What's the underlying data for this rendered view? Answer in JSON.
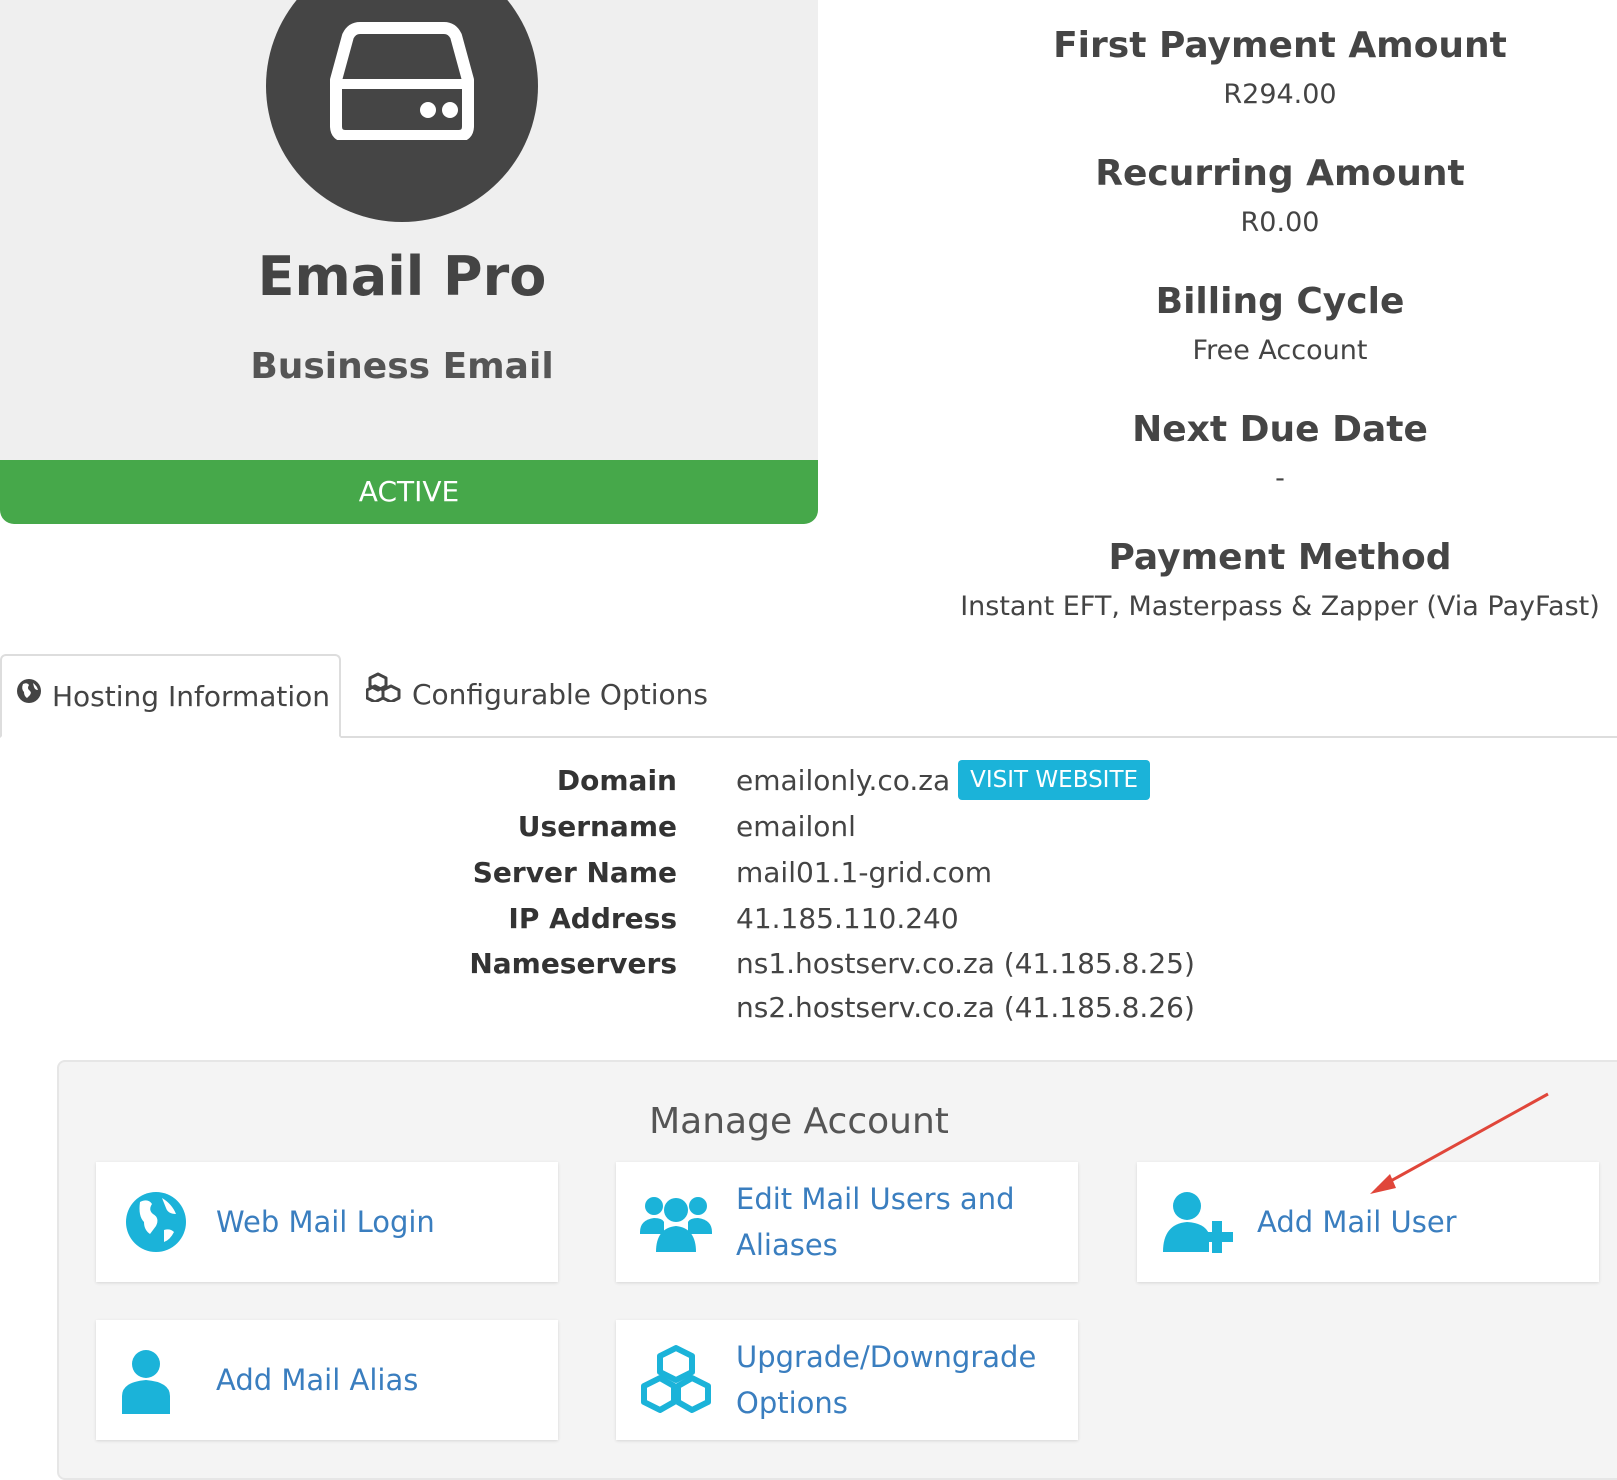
{
  "product": {
    "name": "Email Pro",
    "group": "Business Email",
    "status": "ACTIVE",
    "icon": "hdd-icon"
  },
  "billing": [
    {
      "label": "First Payment Amount",
      "value": "R294.00"
    },
    {
      "label": "Recurring Amount",
      "value": "R0.00"
    },
    {
      "label": "Billing Cycle",
      "value": "Free Account"
    },
    {
      "label": "Next Due Date",
      "value": "-"
    },
    {
      "label": "Payment Method",
      "value": "Instant EFT, Masterpass & Zapper (Via PayFast)"
    }
  ],
  "tabs": {
    "hosting": {
      "label": "Hosting Information",
      "icon": "globe-icon"
    },
    "config": {
      "label": "Configurable Options",
      "icon": "cubes-icon"
    }
  },
  "hosting": {
    "domain_label": "Domain",
    "domain": "emailonly.co.za",
    "visit_label": "VISIT WEBSITE",
    "username_label": "Username",
    "username": "emailonl",
    "server_label": "Server Name",
    "server": "mail01.1-grid.com",
    "ip_label": "IP Address",
    "ip": "41.185.110.240",
    "ns_label": "Nameservers",
    "ns1": "ns1.hostserv.co.za (41.185.8.25)",
    "ns2": "ns2.hostserv.co.za (41.185.8.26)"
  },
  "manage": {
    "title": "Manage Account",
    "tiles": [
      {
        "label": "Web Mail Login",
        "icon": "globe-icon"
      },
      {
        "label": "Edit Mail Users and Aliases",
        "icon": "users-icon"
      },
      {
        "label": "Add Mail User",
        "icon": "user-plus-icon"
      },
      {
        "label": "Add Mail Alias",
        "icon": "user-icon"
      },
      {
        "label": "Upgrade/Downgrade Options",
        "icon": "cubes-icon"
      }
    ]
  },
  "colors": {
    "status_active": "#46a84a",
    "accent": "#1bb3d9",
    "link": "#3a7ebf",
    "annotation_arrow": "#e0463a"
  }
}
